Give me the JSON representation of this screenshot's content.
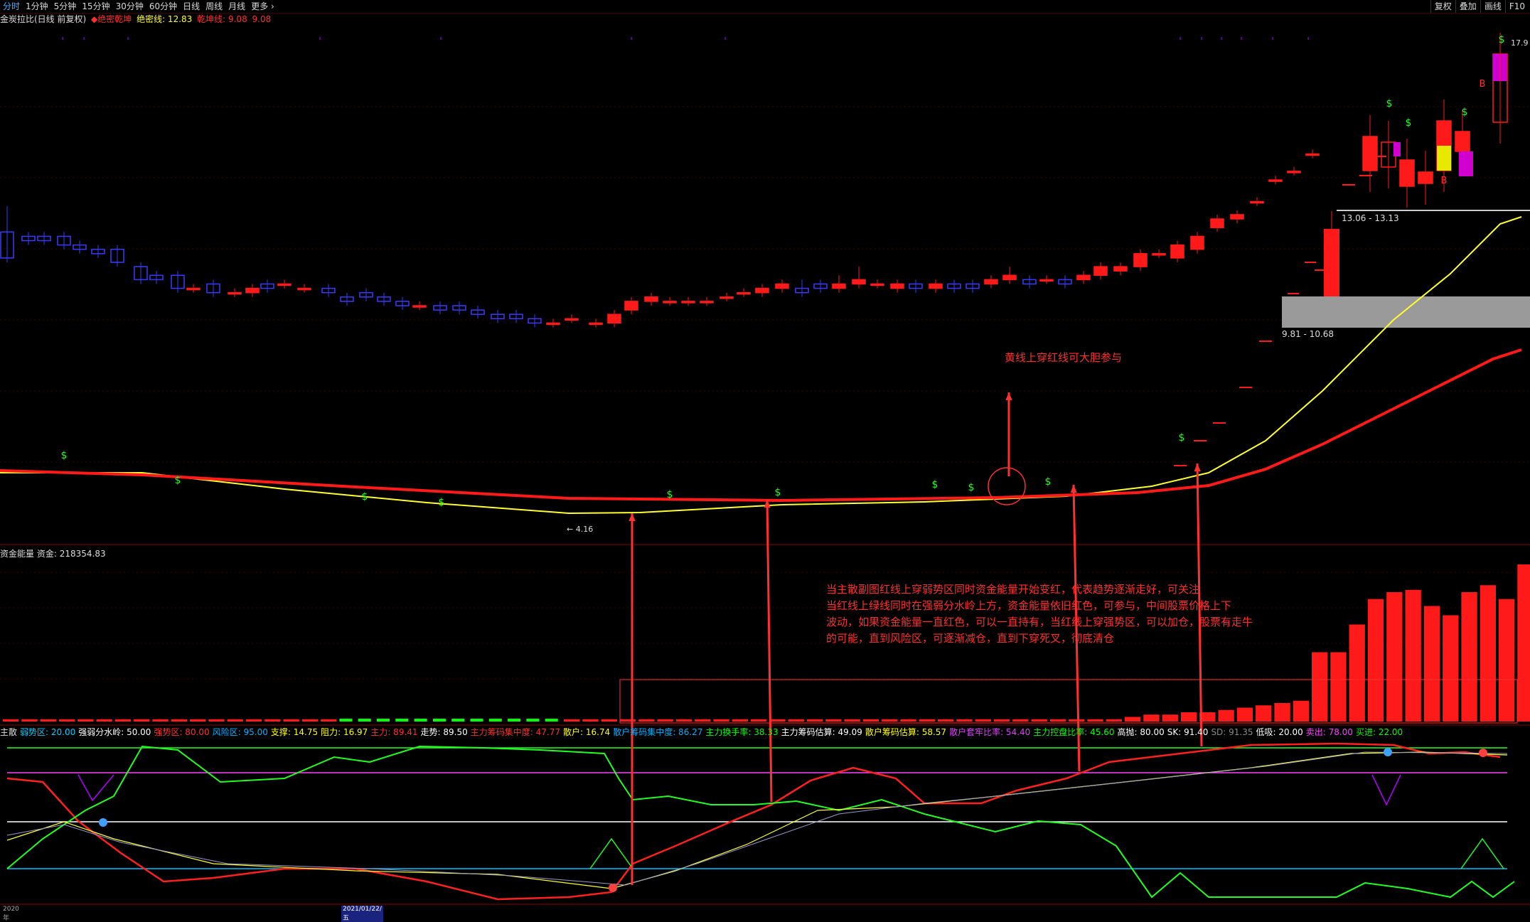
{
  "toolbar": {
    "periods": [
      "分时",
      "1分钟",
      "5分钟",
      "15分钟",
      "30分钟",
      "60分钟",
      "日线",
      "周线",
      "月线",
      "更多 ›"
    ],
    "active_index": 0,
    "right_tools": [
      "复权",
      "叠加",
      "画线",
      "F10"
    ]
  },
  "title_row": {
    "name": "金炭拉比(日线 前复权)",
    "indicator": "◆绝密乾坤",
    "jm_label": "绝密线: 12.83",
    "qk_label": "乾坤线: 9.08",
    "extra": "9.08"
  },
  "price_panel": {
    "upper_zone_label": "13.06 - 13.13",
    "lower_zone_label": "9.81 - 10.68",
    "high_label": "17.9",
    "low_label": "4.16",
    "annotation": "黄线上穿红线可大胆参与"
  },
  "energy_panel": {
    "title": "资金能量",
    "fund_label": "资金: 218354.83",
    "annotation_lines": [
      "当主散副图红线上穿弱势区同时资金能量开始变红，代表趋势逐渐走好，可关注",
      "当红线上绿线同时在强弱分水岭上方，资金能量依旧红色，可参与，中间股票价格上下",
      "波动，如果资金能量一直红色，可以一直持有，当红线上穿强势区，可以加仓，股票有走牛",
      "的可能，直到风险区，可逐渐减仓，直到下穿死叉，彻底清仓"
    ],
    "bars": [
      1,
      1,
      1,
      1,
      1,
      1,
      1,
      1,
      1,
      1,
      1,
      1,
      1,
      1,
      1,
      1,
      1,
      1,
      -1,
      -1,
      -1,
      -1,
      -1,
      -1,
      -1,
      -1,
      -1,
      -1,
      -1,
      -1,
      1,
      1,
      1,
      1,
      1,
      1,
      1,
      1,
      1,
      1,
      1,
      1,
      1,
      1,
      1,
      1,
      1,
      1,
      1,
      1,
      1,
      1,
      1,
      1,
      1,
      1,
      1,
      1,
      1,
      1,
      2,
      3,
      3,
      4,
      4,
      5,
      6,
      7,
      8,
      9,
      30,
      30,
      42,
      53,
      56,
      57,
      50,
      46,
      56,
      59,
      53,
      68,
      70
    ]
  },
  "indicator_panel": {
    "items": [
      {
        "text": "主散",
        "color": "#dddddd"
      },
      {
        "text": "弱势区: 20.00",
        "color": "#00d0ff"
      },
      {
        "text": "强弱分水岭: 50.00",
        "color": "#ffffff"
      },
      {
        "text": "强势区: 80.00",
        "color": "#ff3030"
      },
      {
        "text": "风险区: 95.00",
        "color": "#00b0ff"
      },
      {
        "text": "支撑: 14.75",
        "color": "#ffff00"
      },
      {
        "text": "阻力: 16.97",
        "color": "#ffff00"
      },
      {
        "text": "主力: 89.41",
        "color": "#ff3030"
      },
      {
        "text": "走势: 89.50",
        "color": "#ffffff"
      },
      {
        "text": "主力筹码集中度: 47.77",
        "color": "#ff3030"
      },
      {
        "text": "散户: 16.74",
        "color": "#ffff00"
      },
      {
        "text": "散户筹码集中度: 86.27",
        "color": "#00b0ff"
      },
      {
        "text": "主力换手率: 38.33",
        "color": "#00ff00"
      },
      {
        "text": "主力筹码估算: 49.09",
        "color": "#ffffff"
      },
      {
        "text": "散户筹码估算: 58.57",
        "color": "#ffff00"
      },
      {
        "text": "散户套牢比率: 54.40",
        "color": "#e040ff"
      },
      {
        "text": "主力控盘比率: 45.60",
        "color": "#00ff00"
      },
      {
        "text": "高抛: 80.00",
        "color": "#ffffff"
      },
      {
        "text": "SK: 91.40",
        "color": "#ffffff"
      },
      {
        "text": "SD: 91.35",
        "color": "#888888"
      },
      {
        "text": "低吸: 20.00",
        "color": "#ffffff"
      },
      {
        "text": "卖出: 78.00",
        "color": "#ff40ff"
      },
      {
        "text": "买进: 22.00",
        "color": "#00ff00"
      }
    ]
  },
  "date_bar": {
    "year": "2020年",
    "date": "2021/01/22/五"
  },
  "colors": {
    "up": "#ff1a1a",
    "down": "#3a3aff",
    "yellow_line": "#ffff30",
    "red_line": "#ff1a1a",
    "energy_up": "#ff1a1a",
    "energy_down": "#00ff00",
    "green_line": "#20ff20"
  }
}
